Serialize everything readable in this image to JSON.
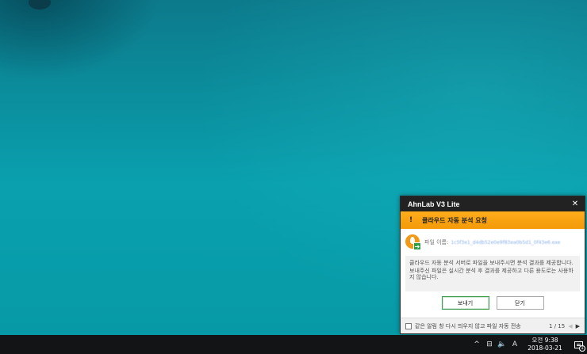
{
  "popup": {
    "title": "AhnLab V3 Lite",
    "banner_text": "클라우드 자동 분석 요청",
    "file_label": "파일 이름:",
    "file_name": "1c5f3e1_d4db52e0e9f83ea0b5d1_0f43e6.exe",
    "info_line1": "클라우드 자동 분석 서버로 파일을 보내주시면 분석 결과를 제공합니다.",
    "info_line2": "보내주신 파일은 실시간 분석 후 결과를 제공하고 다른 용도로는 사용하지 않습니다.",
    "send_button": "보내기",
    "close_button": "닫기",
    "dont_show_label": "같은 알림 창 다시 띄우지 않고 파일 자동 전송",
    "pager": "1 / 15",
    "close_icon": "✕",
    "prev_icon": "◀",
    "next_icon": "▶",
    "banner_icon": "!"
  },
  "taskbar": {
    "tray_chevron": "^",
    "network_icon": "⊟",
    "volume_icon": "🔈",
    "ime_indicator": "A",
    "time": "오전 9:38",
    "date": "2018-03-21",
    "notification_count": "1"
  },
  "colors": {
    "banner": "#f7a010",
    "titlebar": "#222222",
    "primary_button_border": "#3c9c4c",
    "desktop": "#0a95a4"
  }
}
